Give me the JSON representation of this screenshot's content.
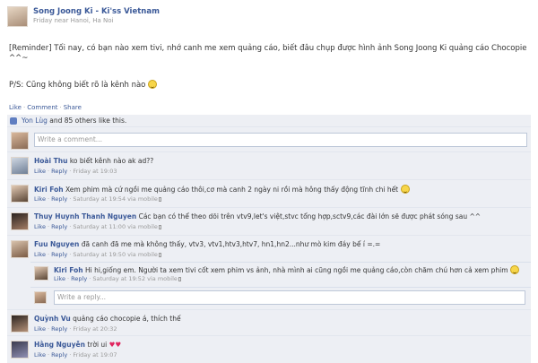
{
  "post": {
    "author": "Song Joong Ki - Ki'ss Vietnam",
    "meta": "Friday near Hanoi, Ha Noi",
    "body": "[Reminder] Tối nay, có bạn nào xem tivi, nhớ canh me xem quảng cáo, biết đâu chụp được hình ảnh Song Joong Ki quảng cáo Chocopie ^^~",
    "ps": "P/S: Cũng không biết rõ là kênh nào",
    "emoji_icon": "smile-emoji"
  },
  "actions": {
    "like": "Like",
    "comment": "Comment",
    "share": "Share"
  },
  "likes": {
    "text_name": "Yon Lùg",
    "text_rest": " and 85 others like this."
  },
  "composer": {
    "placeholder": "Write a comment..."
  },
  "comments": [
    {
      "name": "Hoài Thu",
      "text": " ko biết kênh nào ak ad??",
      "meta_rest": " · Friday at 19:03"
    },
    {
      "name": "Kiri Foh",
      "text": " Xem phim mà cứ ngồi me quảng cáo thôi,cơ mà canh 2 ngày ni rồi mà hông thấy động tĩnh chi hết",
      "meta_rest": " · Saturday at 19:54 via mobile",
      "emoji": true
    },
    {
      "name": "Thuy Huynh Thanh Nguyen",
      "text": " Các bạn có thể theo dõi trên vtv9,let's việt,stvc tổng hợp,sctv9,các đài lớn sẽ được phát sóng sau ^^",
      "meta_rest": " · Saturday at 11:00 via mobile"
    },
    {
      "name": "Fuu Nguyen",
      "text": " đã canh đã me mà không thấy, vtv3, vtv1,htv3,htv7, hn1,hn2...như mò kim đáy bể í =.=",
      "meta_rest": " · Saturday at 19:50 via mobile"
    }
  ],
  "reply": {
    "name": "Kiri Foh",
    "text": " Hi hi,giống em. Người ta xem tivi cốt xem phim vs ảnh, nhà mình ai cũng ngồi me quảng cáo,còn chăm chú hơn cả xem phim",
    "meta_rest": " · Saturday at 19:52 via mobile",
    "placeholder": "Write a reply..."
  },
  "comments2": [
    {
      "name": "Quỳnh Vu",
      "text": " quảng cáo chocopie á, thích thế",
      "meta_rest": " · Friday at 20:32"
    },
    {
      "name": "Hằng Nguyễn",
      "text": " trời ui",
      "meta_rest": " · Friday at 19:07"
    }
  ],
  "labels": {
    "like": "Like",
    "reply": "Reply"
  }
}
